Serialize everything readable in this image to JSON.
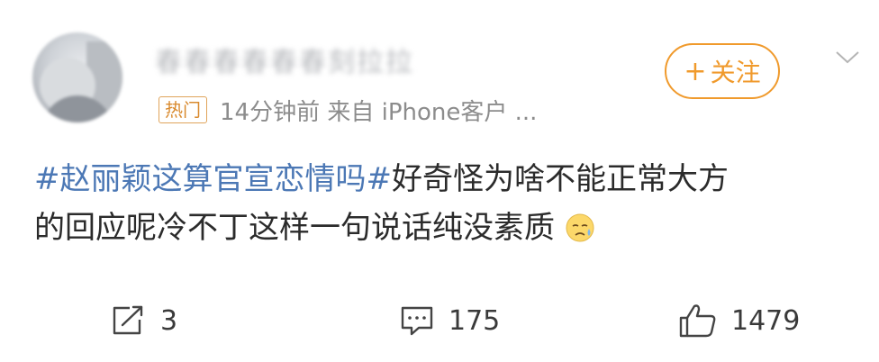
{
  "post": {
    "username": "春春春春春春刻拉拉",
    "hot_badge": "热门",
    "meta": "14分钟前   来自 iPhone客户 ...",
    "follow_plus": "+",
    "follow_label": "关注",
    "topic": "#赵丽颖这算官宣恋情吗#",
    "text_line1": "好奇怪为啥不能正常大方",
    "text_line2": "的回应呢冷不丁这样一句说话纯没素质",
    "emoji": "sweat-cry-emoji"
  },
  "actions": {
    "share_count": "3",
    "comment_count": "175",
    "like_count": "1479"
  },
  "colors": {
    "topic": "#4c78b5",
    "follow": "#f09a2c",
    "hot_badge": "#d98a2e",
    "meta": "#8c8c8c"
  }
}
